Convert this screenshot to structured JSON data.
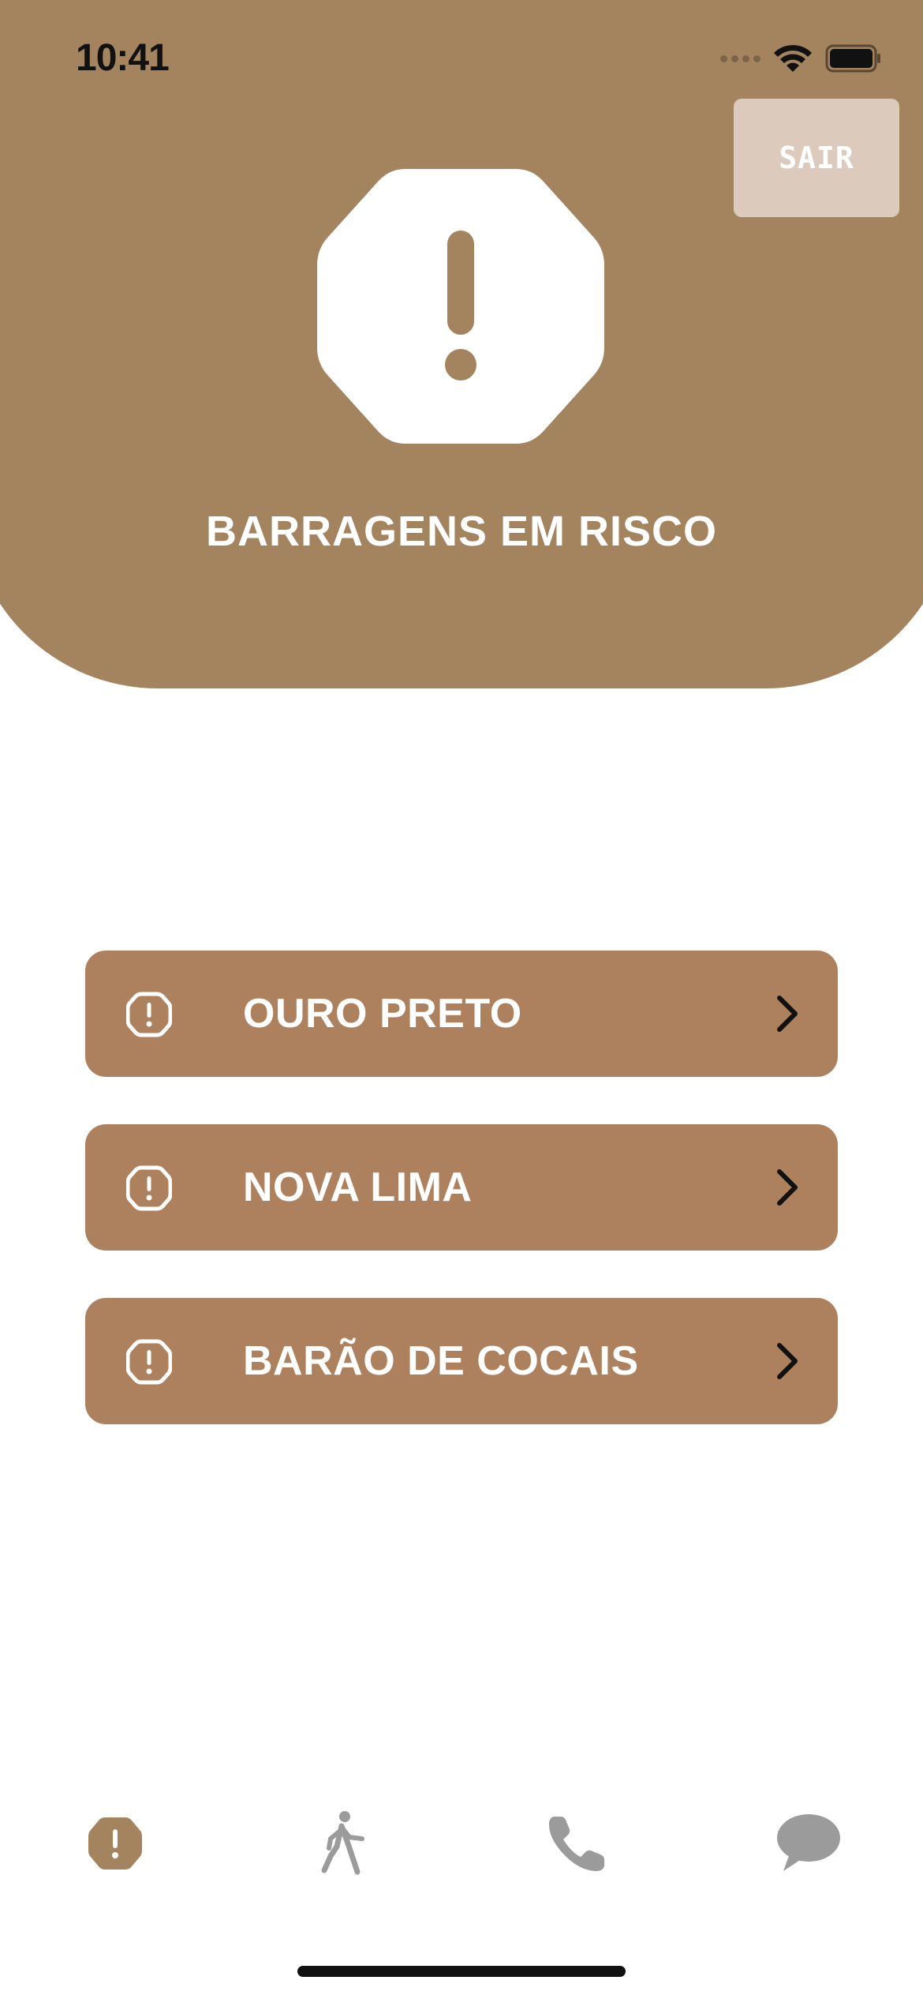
{
  "status_bar": {
    "time": "10:41"
  },
  "header": {
    "exit_label": "SAIR",
    "title": "BARRAGENS EM RISCO",
    "icon": "alert-octagon-icon"
  },
  "cities": [
    {
      "label": "OURO PRETO",
      "icon": "alert-octagon-icon"
    },
    {
      "label": "NOVA LIMA",
      "icon": "alert-octagon-icon"
    },
    {
      "label": "BARÃO DE COCAIS",
      "icon": "alert-octagon-icon"
    }
  ],
  "tabbar": {
    "items": [
      {
        "icon": "alert-octagon-icon",
        "active": true
      },
      {
        "icon": "walking-person-icon",
        "active": false
      },
      {
        "icon": "phone-icon",
        "active": false
      },
      {
        "icon": "chat-bubble-icon",
        "active": false
      }
    ]
  },
  "colors": {
    "header_bg": "#a3845f",
    "item_bg": "#ad815e",
    "exit_bg": "#dccbbc",
    "tab_active": "#a3845f",
    "tab_inactive": "#9b9b9b"
  }
}
